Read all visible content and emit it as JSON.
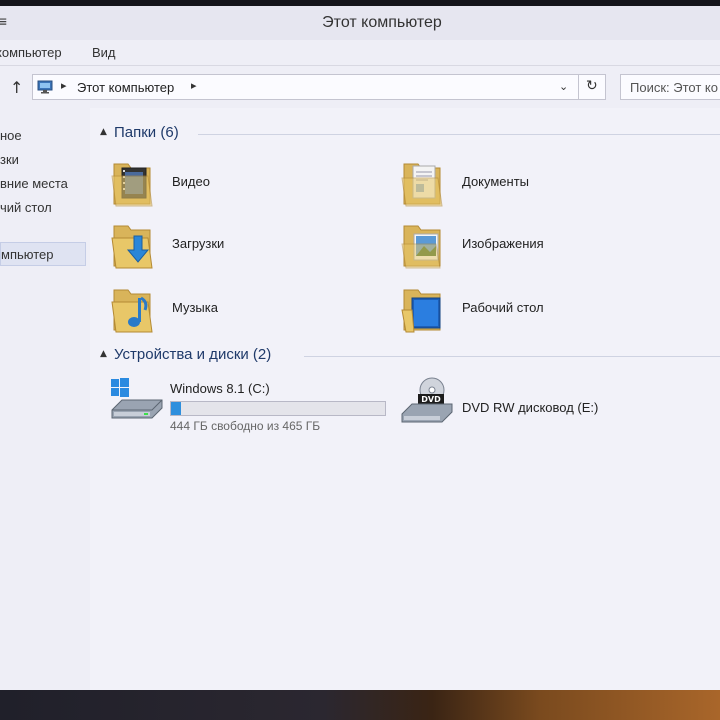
{
  "window": {
    "title": "Этот компьютер"
  },
  "ribbon": {
    "tabs": [
      "компьютер",
      "Вид"
    ]
  },
  "address": {
    "crumb": "Этот компьютер"
  },
  "search": {
    "text": "Поиск: Этот ко"
  },
  "nav": {
    "items": [
      {
        "label": "ное"
      },
      {
        "label": "зки"
      },
      {
        "label": "вние места"
      },
      {
        "label": "чий стол"
      },
      {
        "label": "мпьютер",
        "selected": true
      }
    ]
  },
  "groups": {
    "folders": {
      "title": "Папки (6)",
      "items": [
        {
          "label": "Видео",
          "icon": "video-folder-icon"
        },
        {
          "label": "Документы",
          "icon": "documents-folder-icon"
        },
        {
          "label": "Загрузки",
          "icon": "downloads-folder-icon"
        },
        {
          "label": "Изображения",
          "icon": "pictures-folder-icon"
        },
        {
          "label": "Музыка",
          "icon": "music-folder-icon"
        },
        {
          "label": "Рабочий стол",
          "icon": "desktop-folder-icon"
        }
      ]
    },
    "devices": {
      "title": "Устройства и диски (2)",
      "items": [
        {
          "name": "Windows 8.1 (C:)",
          "free_text": "444 ГБ свободно из 465 ГБ",
          "used_fraction": 0.045,
          "icon": "hard-drive-icon"
        },
        {
          "name": "DVD RW дисковод (E:)",
          "icon": "dvd-drive-icon"
        }
      ]
    }
  },
  "colors": {
    "accent": "#2e8fdd",
    "group_title": "#1f3a6a",
    "window_bg": "#eeeef6"
  }
}
